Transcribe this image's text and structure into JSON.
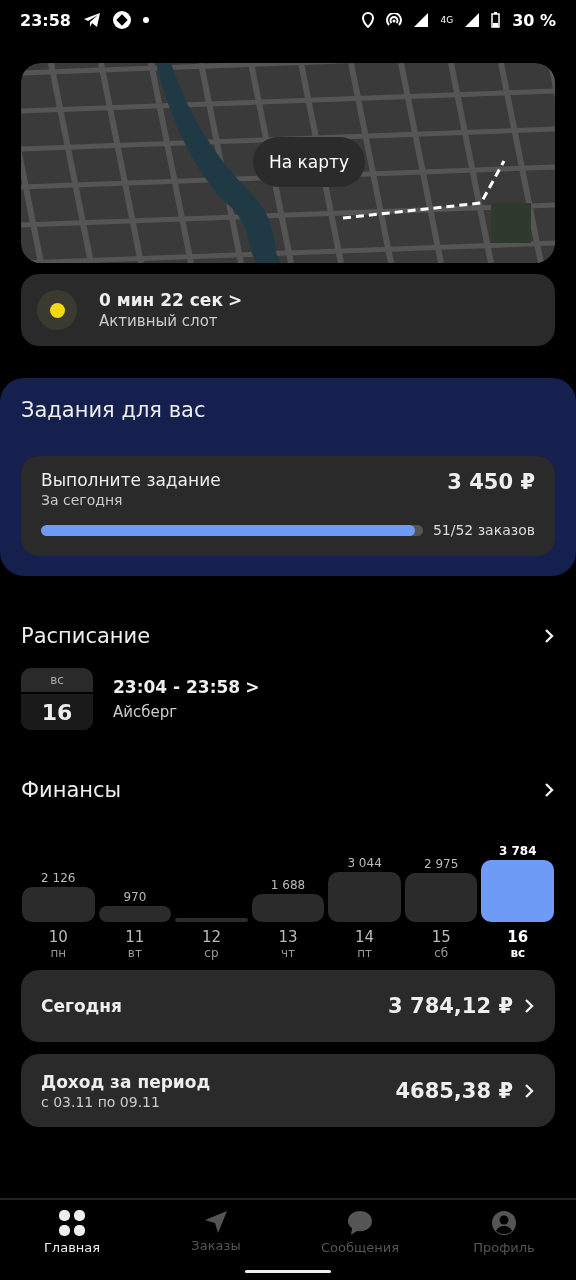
{
  "status_bar": {
    "time": "23:58",
    "battery": "30 %",
    "network": "4G"
  },
  "map": {
    "button": "На карту"
  },
  "slot": {
    "time": "0 мин 22 сек",
    "chevron": ">",
    "label": "Активный слот",
    "active": true
  },
  "tasks": {
    "title": "Задания для вас",
    "card": {
      "title": "Выполните задание",
      "subtitle": "За сегодня",
      "reward": "3 450 ₽",
      "level": 0.98,
      "progress": "51/52 заказов"
    }
  },
  "schedule": {
    "title": "Расписание",
    "weekday": "вс",
    "date": "16",
    "time": "23:04 - 23:58",
    "chevron": ">",
    "place": "Айсберг"
  },
  "finances": {
    "title": "Финансы",
    "days": [
      {
        "date": "10",
        "weekday": "пн",
        "amount": "2 126",
        "selected": false
      },
      {
        "date": "11",
        "weekday": "вт",
        "amount": "970",
        "selected": false
      },
      {
        "date": "12",
        "weekday": "ср",
        "selected": false
      },
      {
        "date": "13",
        "weekday": "чт",
        "amount": "1 688",
        "selected": false
      },
      {
        "date": "14",
        "weekday": "пт",
        "amount": "3 044",
        "selected": false
      },
      {
        "date": "15",
        "weekday": "сб",
        "amount": "2 975",
        "selected": false
      },
      {
        "date": "16",
        "weekday": "вс",
        "amount": "3 784",
        "selected": true
      }
    ],
    "today": {
      "label": "Сегодня",
      "value": "3 784,12 ₽"
    },
    "period": {
      "label": "Доход за период",
      "range": "с 03.11 по 09.11",
      "value": "4685,38 ₽"
    }
  },
  "nav": [
    {
      "label": "Главная",
      "selected": true
    },
    {
      "label": "Заказы",
      "selected": false
    },
    {
      "label": "Сообщения",
      "selected": false
    },
    {
      "label": "Профиль",
      "selected": false
    }
  ]
}
